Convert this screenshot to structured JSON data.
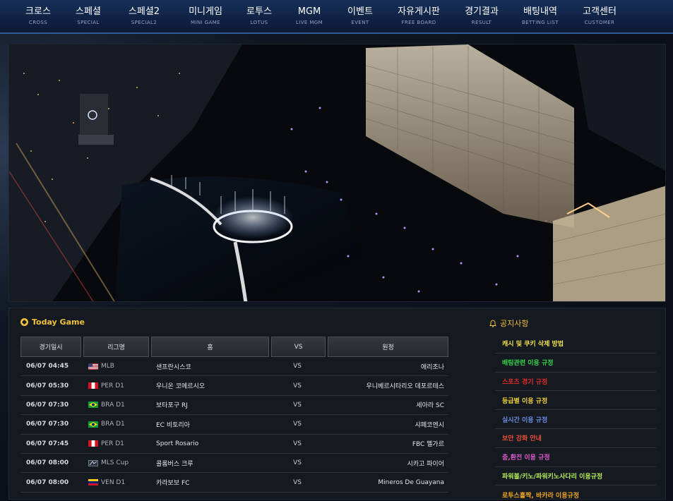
{
  "nav": [
    {
      "ko": "크로스",
      "en": "CROSS",
      "w": 72
    },
    {
      "ko": "스페셜",
      "en": "SPECIAL",
      "w": 70
    },
    {
      "ko": "스페셜2",
      "en": "SPECIAL2",
      "w": 88
    },
    {
      "ko": "미니게임",
      "en": "MINI GAME",
      "w": 86
    },
    {
      "ko": "로투스",
      "en": "LOTUS",
      "w": 66
    },
    {
      "ko": "MGM",
      "en": "LIVE MGM",
      "w": 76
    },
    {
      "ko": "이벤트",
      "en": "EVENT",
      "w": 68
    },
    {
      "ko": "자유게시판",
      "en": "FREE BOARD",
      "w": 98
    },
    {
      "ko": "경기결과",
      "en": "RESULT",
      "w": 80
    },
    {
      "ko": "배팅내역",
      "en": "BETTING LIST",
      "w": 86
    },
    {
      "ko": "고객센터",
      "en": "CUSTOMER",
      "w": 82
    }
  ],
  "today": {
    "title": "Today Game",
    "icon": "soccer-ball-icon",
    "headers": [
      "경기일시",
      "리그명",
      "홈",
      "VS",
      "원정"
    ],
    "games": [
      {
        "time": "06/07 04:45",
        "flag": "usa",
        "league": "MLB",
        "home": "샌프란시스코",
        "vs": "VS",
        "away": "애리조나"
      },
      {
        "time": "06/07 05:30",
        "flag": "peru",
        "league": "PER D1",
        "home": "우니온 코메르시오",
        "vs": "VS",
        "away": "우니베르시타리오 데포르테스"
      },
      {
        "time": "06/07 07:30",
        "flag": "brazil",
        "league": "BRA D1",
        "home": "보타포구 RJ",
        "vs": "VS",
        "away": "세아라 SC"
      },
      {
        "time": "06/07 07:30",
        "flag": "brazil",
        "league": "BRA D1",
        "home": "EC 비토리아",
        "vs": "VS",
        "away": "샤페코엔시"
      },
      {
        "time": "06/07 07:45",
        "flag": "peru",
        "league": "PER D1",
        "home": "Sport Rosario",
        "vs": "VS",
        "away": "FBC 멜가르"
      },
      {
        "time": "06/07 08:00",
        "flag": "mls",
        "league": "MLS Cup",
        "home": "콜롬버스 크루",
        "vs": "VS",
        "away": "시카고 파이어"
      },
      {
        "time": "06/07 08:00",
        "flag": "venezuela",
        "league": "VEN D1",
        "home": "카라보보 FC",
        "vs": "VS",
        "away": "Mineros De Guayana"
      }
    ]
  },
  "notices": {
    "title": "공지사항",
    "icon": "bell-icon",
    "items": [
      {
        "text": "캐시 및 쿠키 삭제 방법",
        "color": "#f0e24a"
      },
      {
        "text": "배팅관련 이용 규정",
        "color": "#33d64a"
      },
      {
        "text": "스포츠 경기 규정",
        "color": "#e02c2c"
      },
      {
        "text": "등급별 이용 규정",
        "color": "#f0d23a"
      },
      {
        "text": "실시간 이용 규정",
        "color": "#6b8fe6"
      },
      {
        "text": "보안 강화 안내",
        "color": "#e8503a"
      },
      {
        "text": "충,환전 이용 규정",
        "color": "#e05ad0"
      },
      {
        "text": "파워볼/키노/파워키노사다리 이용규정",
        "color": "#b6ef5a"
      },
      {
        "text": "로투스홀짝, 바카라 이용규정",
        "color": "#f0a820"
      }
    ]
  },
  "colors": {
    "accent": "#f2c23b",
    "nav_bg": "#0f2142"
  }
}
